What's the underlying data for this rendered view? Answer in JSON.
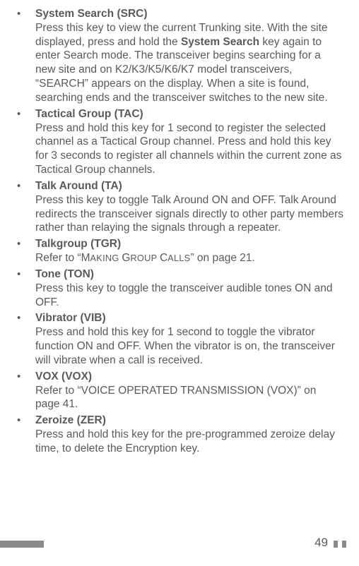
{
  "items": [
    {
      "title": "System Search (SRC)",
      "desc_pre": "Press this key to view the current Trunking site.  With the site displayed, press and hold the ",
      "desc_bold": "System Search",
      "desc_post": " key again to enter Search mode.  The transceiver begins searching for a new site and on K2/K3/K5/K6/K7 model transceivers, “SEARCH” appears on the display.  When a site is found, searching ends and the transceiver switches to the new site."
    },
    {
      "title": "Tactical Group (TAC)",
      "desc": "Press and hold this key for 1 second to register the selected channel as a Tactical Group channel.  Press and hold this key for 3 seconds to register all channels within the current zone as Tactical Group channels."
    },
    {
      "title": "Talk Around (TA)",
      "desc": "Press this key to toggle Talk Around ON and OFF. Talk Around redirects the transceiver signals directly to other party members rather than relaying the signals through a repeater."
    },
    {
      "title": "Talkgroup (TGR)",
      "desc_pre": "Refer to “",
      "desc_sc_first": "M",
      "desc_sc_rest": "aking ",
      "desc_sc_first2": "G",
      "desc_sc_rest2": "roup ",
      "desc_sc_first3": "C",
      "desc_sc_rest3": "alls",
      "desc_post": "” on page 21."
    },
    {
      "title": "Tone (TON)",
      "desc": "Press this key to toggle the transceiver audible tones ON and OFF."
    },
    {
      "title": "Vibrator (VIB)",
      "desc": "Press and hold this key for 1 second to toggle the vibrator function ON and OFF.  When the vibrator is on, the transceiver will vibrate when a call is received."
    },
    {
      "title": "VOX (VOX)",
      "desc": "Refer to “VOICE OPERATED TRANSMISSION (VOX)” on page 41."
    },
    {
      "title": "Zeroize (ZER)",
      "desc": "Press and hold this key for the pre-programmed zeroize delay time, to delete the Encryption key."
    }
  ],
  "page_number": "49",
  "bullet": "•"
}
